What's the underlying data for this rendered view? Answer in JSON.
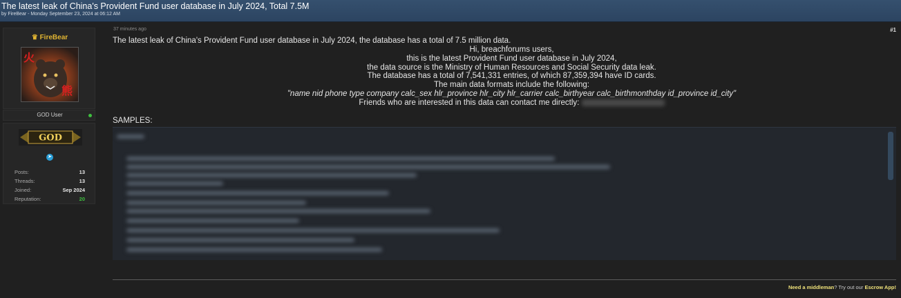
{
  "thread": {
    "title": "The latest leak of China's Provident Fund user database in July 2024, Total 7.5M",
    "meta": "by FireBear - Monday September 23, 2024 at 06:12 AM"
  },
  "author": {
    "username": "FireBear",
    "rank": "GOD User",
    "badge": "GOD",
    "stats": [
      {
        "label": "Posts:",
        "value": "13"
      },
      {
        "label": "Threads:",
        "value": "13"
      },
      {
        "label": "Joined:",
        "value": "Sep 2024"
      },
      {
        "label": "Reputation:",
        "value": "20"
      }
    ]
  },
  "post": {
    "timestamp": "37 minutes ago",
    "number": "#1",
    "intro": "The latest leak of China's Provident Fund user database in July 2024, the database has a total of 7.5 million data.",
    "lines": [
      "Hi, breachforums users,",
      "this is the latest Provident Fund user database in July 2024,",
      "the data source is the Ministry of Human Resources and Social Security data leak.",
      "The database has a total of 7,541,331 entries, of which 87,359,394 have ID cards.",
      "The main data formats include the following:"
    ],
    "formats": "\"name nid phone type company calc_sex hlr_province hlr_city hlr_carrier calc_birthyear calc_birthmonthday id_province id_city\"",
    "contact": "Friends who are interested in this data can contact me directly:",
    "samples_label": "SAMPLES:"
  },
  "footer": {
    "prefix": "Need a",
    "middleman": "middleman",
    "mid": "? Try out our",
    "escrow": "Escrow App!"
  },
  "colors": {
    "header": "#2f4a68",
    "background": "#202020",
    "username": "#e0b432",
    "online": "#3fbf3f",
    "reputation": "#3fbf3f"
  }
}
